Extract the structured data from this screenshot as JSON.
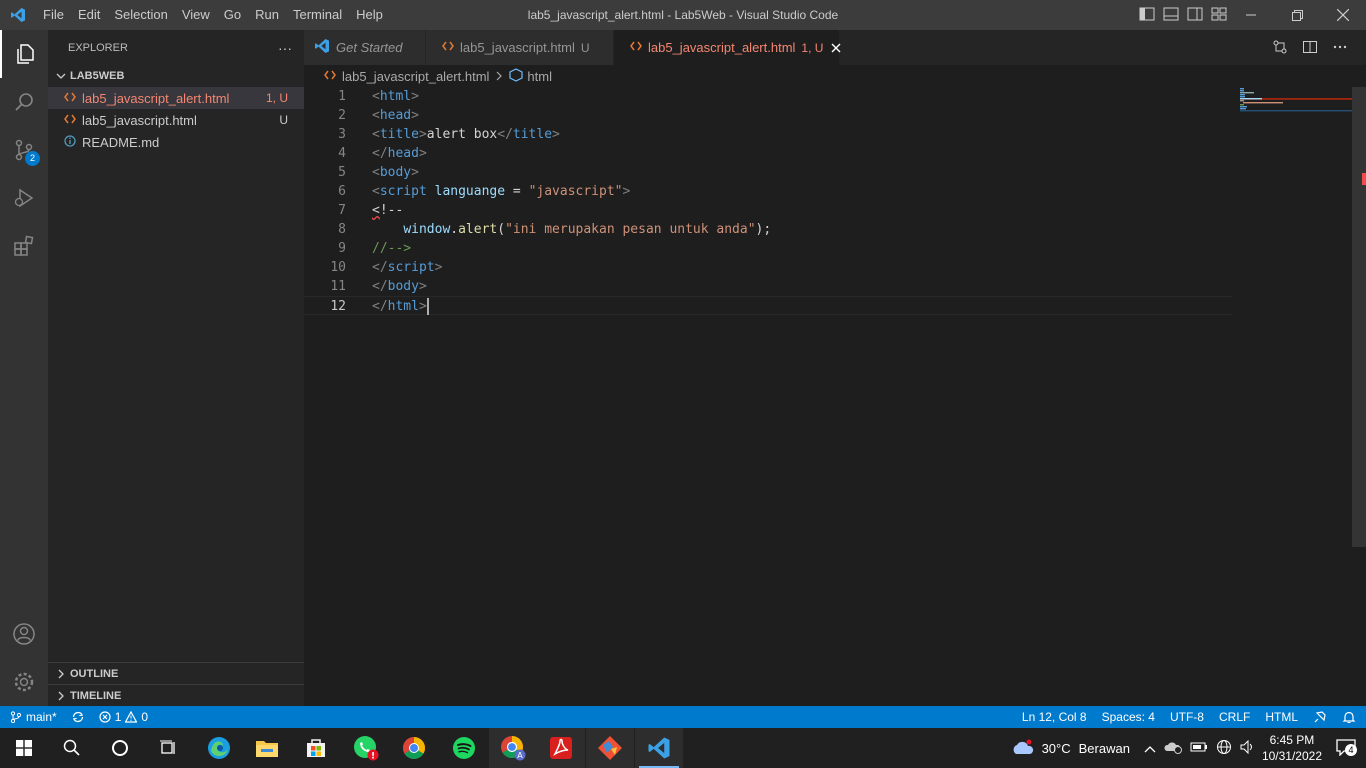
{
  "titlebar": {
    "menus": [
      "File",
      "Edit",
      "Selection",
      "View",
      "Go",
      "Run",
      "Terminal",
      "Help"
    ],
    "title": "lab5_javascript_alert.html - Lab5Web - Visual Studio Code"
  },
  "activity": {
    "scm_badge": "2"
  },
  "sidebar": {
    "header": "EXPLORER",
    "more": "···",
    "folder": "LAB5WEB",
    "files": [
      {
        "name": "lab5_javascript_alert.html",
        "status": "1, U"
      },
      {
        "name": "lab5_javascript.html",
        "status": "U"
      },
      {
        "name": "README.md",
        "status": ""
      }
    ],
    "outline": "OUTLINE",
    "timeline": "TIMELINE"
  },
  "tabs": [
    {
      "label": "Get Started",
      "status": ""
    },
    {
      "label": "lab5_javascript.html",
      "status": "U"
    },
    {
      "label": "lab5_javascript_alert.html",
      "status": "1, U"
    }
  ],
  "breadcrumb": {
    "file": "lab5_javascript_alert.html",
    "symbol": "html"
  },
  "editor": {
    "line_numbers": [
      "1",
      "2",
      "3",
      "4",
      "5",
      "6",
      "7",
      "8",
      "9",
      "10",
      "11",
      "12"
    ]
  },
  "statusbar": {
    "branch": "main*",
    "errors": "1",
    "warnings": "0",
    "position": "Ln 12, Col 8",
    "spaces": "Spaces: 4",
    "encoding": "UTF-8",
    "eol": "CRLF",
    "language": "HTML"
  },
  "taskbar": {
    "weather": "30°C",
    "weather_text": "Berawan",
    "time": "6:45 PM",
    "date": "10/31/2022",
    "notifications": "4"
  },
  "colors": {
    "accent": "#007acc",
    "modified_file": "#f48771",
    "tag": "#569cd6",
    "string": "#ce9178",
    "comment": "#6a9955"
  }
}
